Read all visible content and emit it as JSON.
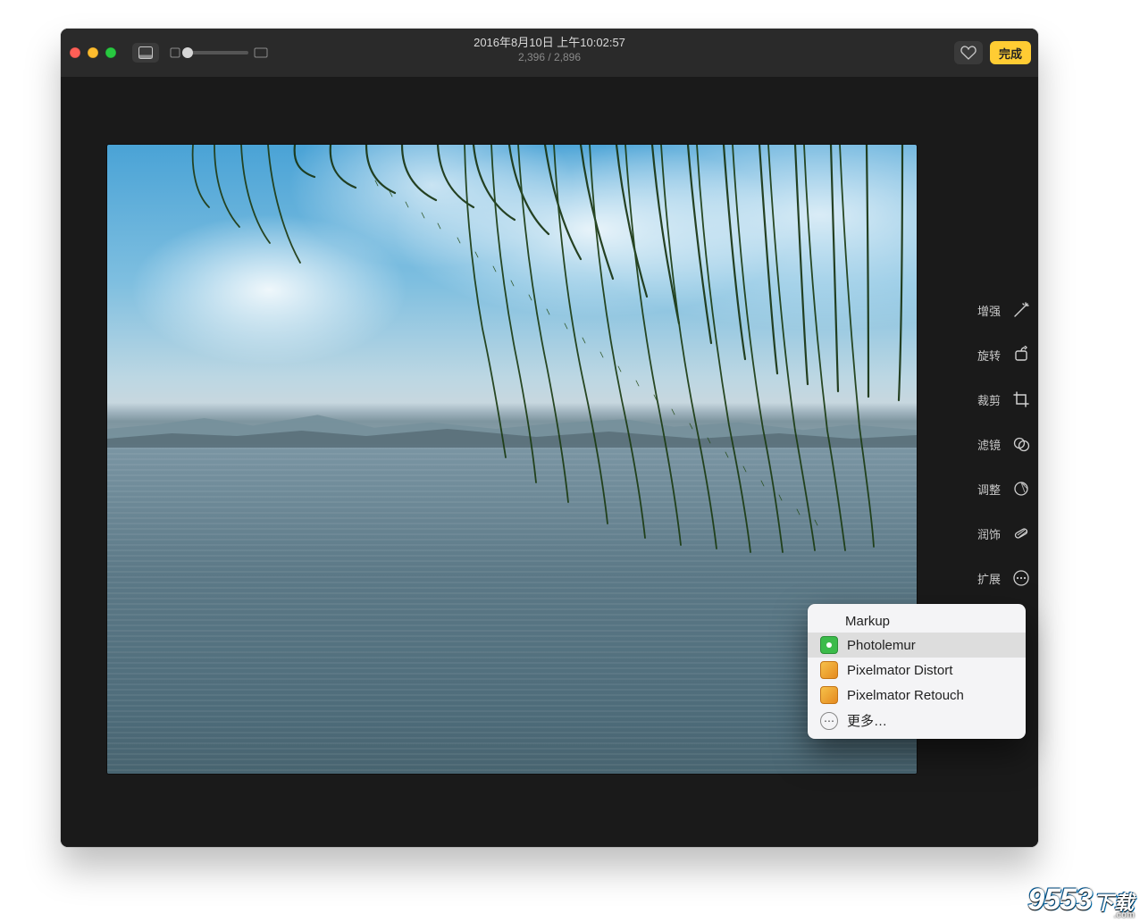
{
  "window": {
    "title": "2016年8月10日 上午10:02:57",
    "counter": "2,396 / 2,896",
    "done_label": "完成"
  },
  "tools": [
    {
      "id": "enhance",
      "label": "增强",
      "icon": "wand-icon"
    },
    {
      "id": "rotate",
      "label": "旋转",
      "icon": "rotate-icon"
    },
    {
      "id": "crop",
      "label": "裁剪",
      "icon": "crop-icon"
    },
    {
      "id": "filters",
      "label": "滤镜",
      "icon": "filters-icon"
    },
    {
      "id": "adjust",
      "label": "调整",
      "icon": "adjust-icon"
    },
    {
      "id": "retouch",
      "label": "润饰",
      "icon": "retouch-icon"
    },
    {
      "id": "extend",
      "label": "扩展",
      "icon": "ellipsis-icon"
    }
  ],
  "menu": {
    "items": [
      {
        "label": "Markup",
        "icon": "none",
        "highlight": false
      },
      {
        "label": "Photolemur",
        "icon": "green",
        "highlight": true
      },
      {
        "label": "Pixelmator Distort",
        "icon": "px",
        "highlight": false
      },
      {
        "label": "Pixelmator Retouch",
        "icon": "px",
        "highlight": false
      },
      {
        "label": "更多…",
        "icon": "more",
        "highlight": false
      }
    ]
  },
  "watermark": {
    "brand_big": "9553",
    "brand_small": "下载",
    "brand_sub": ".com"
  }
}
